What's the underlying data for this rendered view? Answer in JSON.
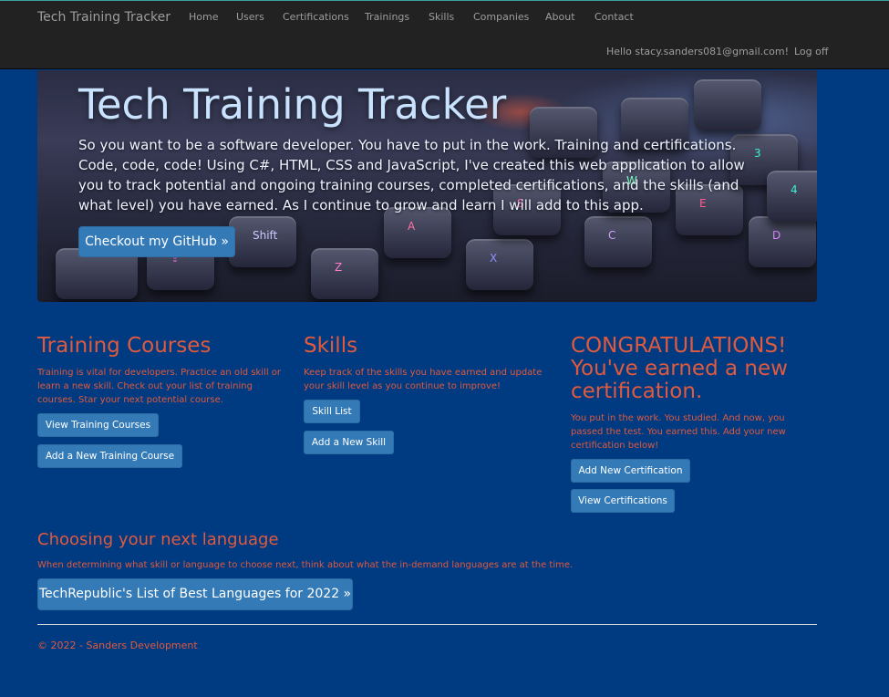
{
  "navbar": {
    "brand": "Tech Training Tracker",
    "links": [
      "Home",
      "Users",
      "Certifications",
      "Trainings",
      "Skills",
      "Companies",
      "About",
      "Contact"
    ],
    "greeting": "Hello stacy.sanders081@gmail.com!",
    "logoff": "Log off"
  },
  "jumbotron": {
    "title": "Tech Training Tracker",
    "text": "So you want to be a software developer. You have to put in the work. Training and certifications. Code, code, code! Using C#, HTML, CSS and JavaScript, I've created this web application to allow you to track potential and ongoing training courses, completed certifications, and the skills (and what level) you have earned. As I continue to grow and learn I will add to this app.",
    "button": "Checkout my GitHub »"
  },
  "training": {
    "title": "Training Courses",
    "text": "Training is vital for developers. Practice an old skill or learn a new skill. Check out your list of training courses. Star your next potential course.",
    "view_button": "View Training Courses",
    "add_button": "Add a New Training Course"
  },
  "skills": {
    "title": "Skills",
    "text": "Keep track of the skills you have earned and update your skill level as you continue to improve!",
    "list_button": "Skill List",
    "add_button": "Add a New Skill"
  },
  "certification": {
    "title_line1": "CONGRATULATIONS!",
    "title_line2": "You've earned a new",
    "title_line3": "certification.",
    "text": "You put in the work. You studied. And now, you passed the test. You earned this. Add your new certification below!",
    "add_button": "Add New Certification",
    "view_button": "View Certifications"
  },
  "language": {
    "title": "Choosing your next language",
    "text": "When determining what skill or language to choose next, think about what the in-demand languages are at the time.",
    "button": "TechRepublic's List of Best Languages for 2022 »"
  },
  "footer": {
    "text": "© 2022 - Sanders Development"
  },
  "colors": {
    "background": "#003a80",
    "navbar": "#222222",
    "accent_text": "#e05a3f",
    "button": "#337ab7"
  }
}
